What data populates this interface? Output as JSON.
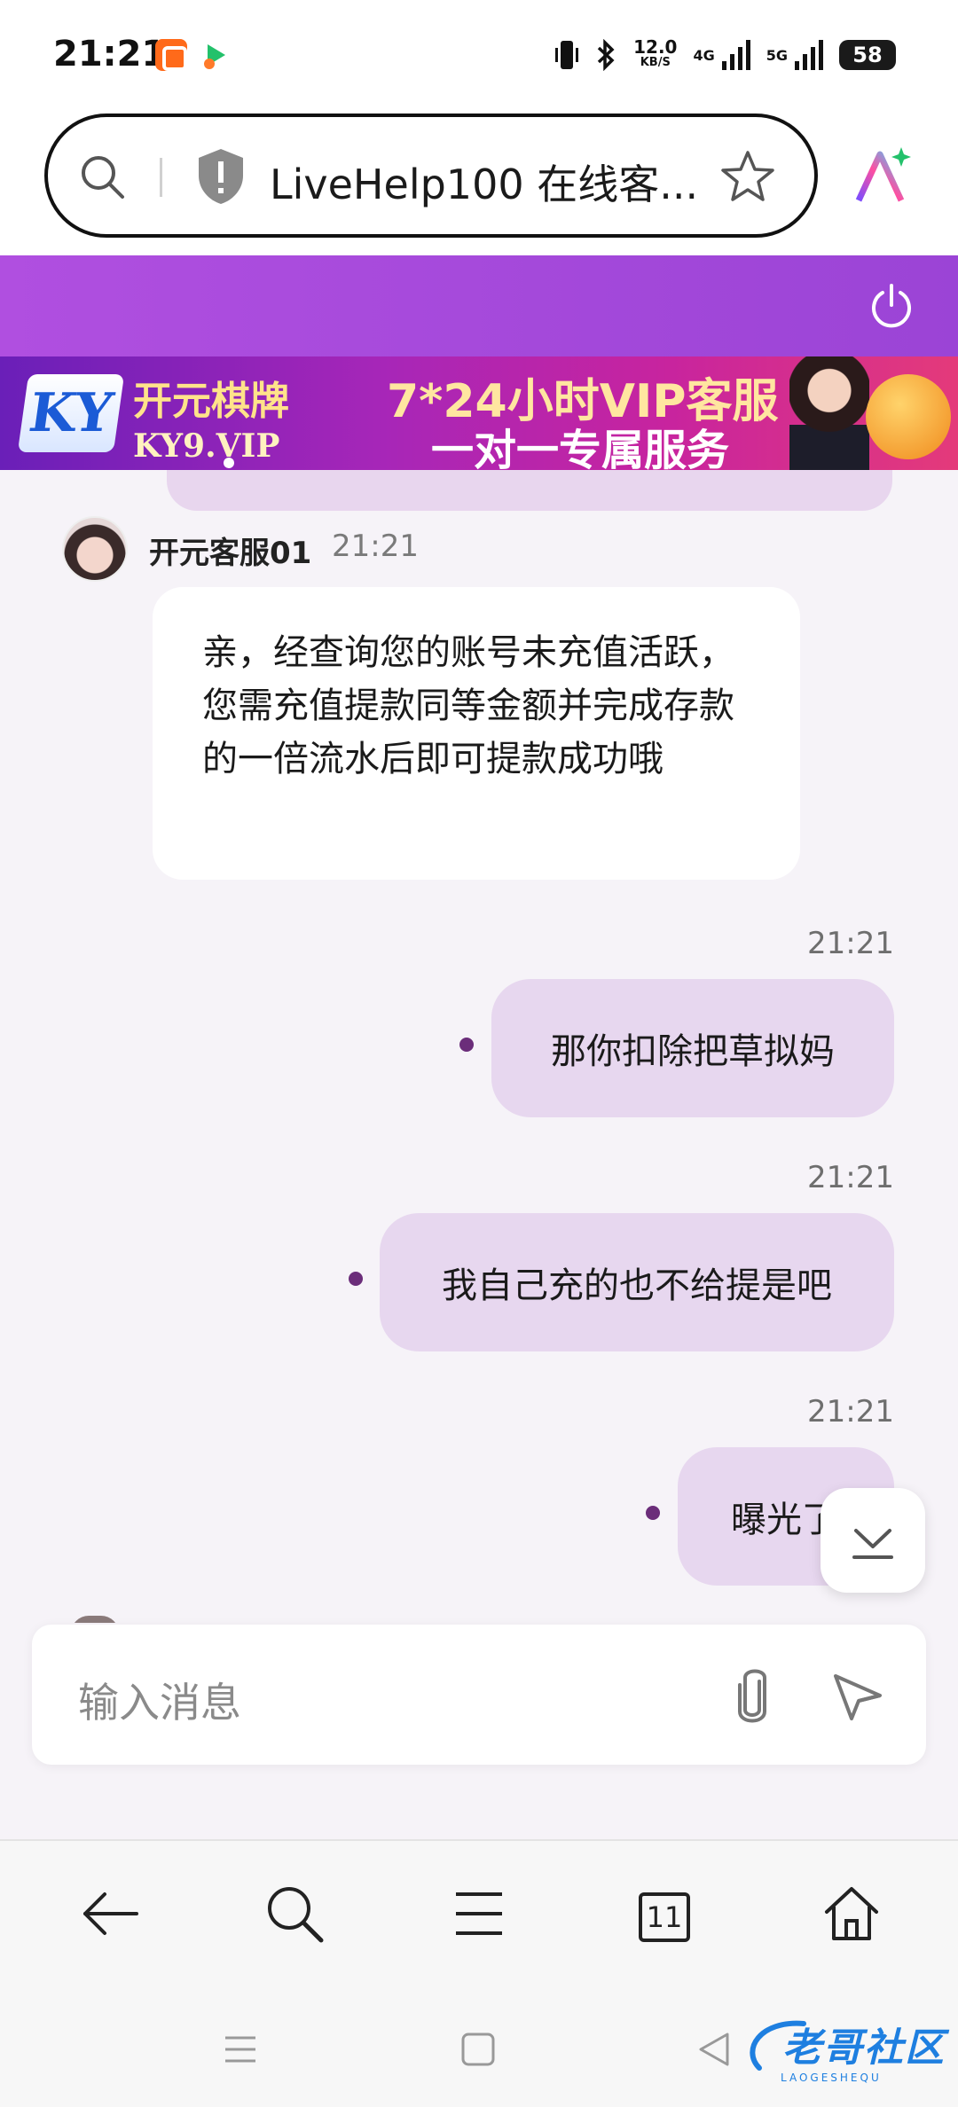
{
  "status_bar": {
    "time": "21:21",
    "speed": "12.0",
    "speed_unit": "KB/S",
    "net1": "4G",
    "net2": "5G",
    "battery": "58"
  },
  "browser": {
    "url_title": "LiveHelp100 在线客...",
    "tab_count": "11"
  },
  "banner": {
    "logo_text": "KY",
    "brand_cn": "开元棋牌",
    "brand_en": "KY9.VIP",
    "tagline1": "7*24小时VIP客服",
    "tagline2": "一对一专属服务"
  },
  "chat": {
    "agent_name": "开元客服01",
    "agent_time": "21:21",
    "agent_message": "亲，经查询您的账号未充值活跃，您需充值提款同等金额并完成存款的一倍流水后即可提款成功哦",
    "user_messages": [
      {
        "time": "21:21",
        "text": "那你扣除把草拟妈"
      },
      {
        "time": "21:21",
        "text": "我自己充的也不给提是吧"
      },
      {
        "time": "21:21",
        "text": "曝光了"
      }
    ]
  },
  "input": {
    "placeholder": "输入消息"
  },
  "watermark": {
    "text": "老哥社区",
    "sub": "LAOGESHEQU"
  },
  "colors": {
    "header_purple": "#a849dc",
    "user_bubble": "#e7d7ef",
    "sent_dot": "#6b2d7a",
    "background": "#f6f3f8"
  }
}
